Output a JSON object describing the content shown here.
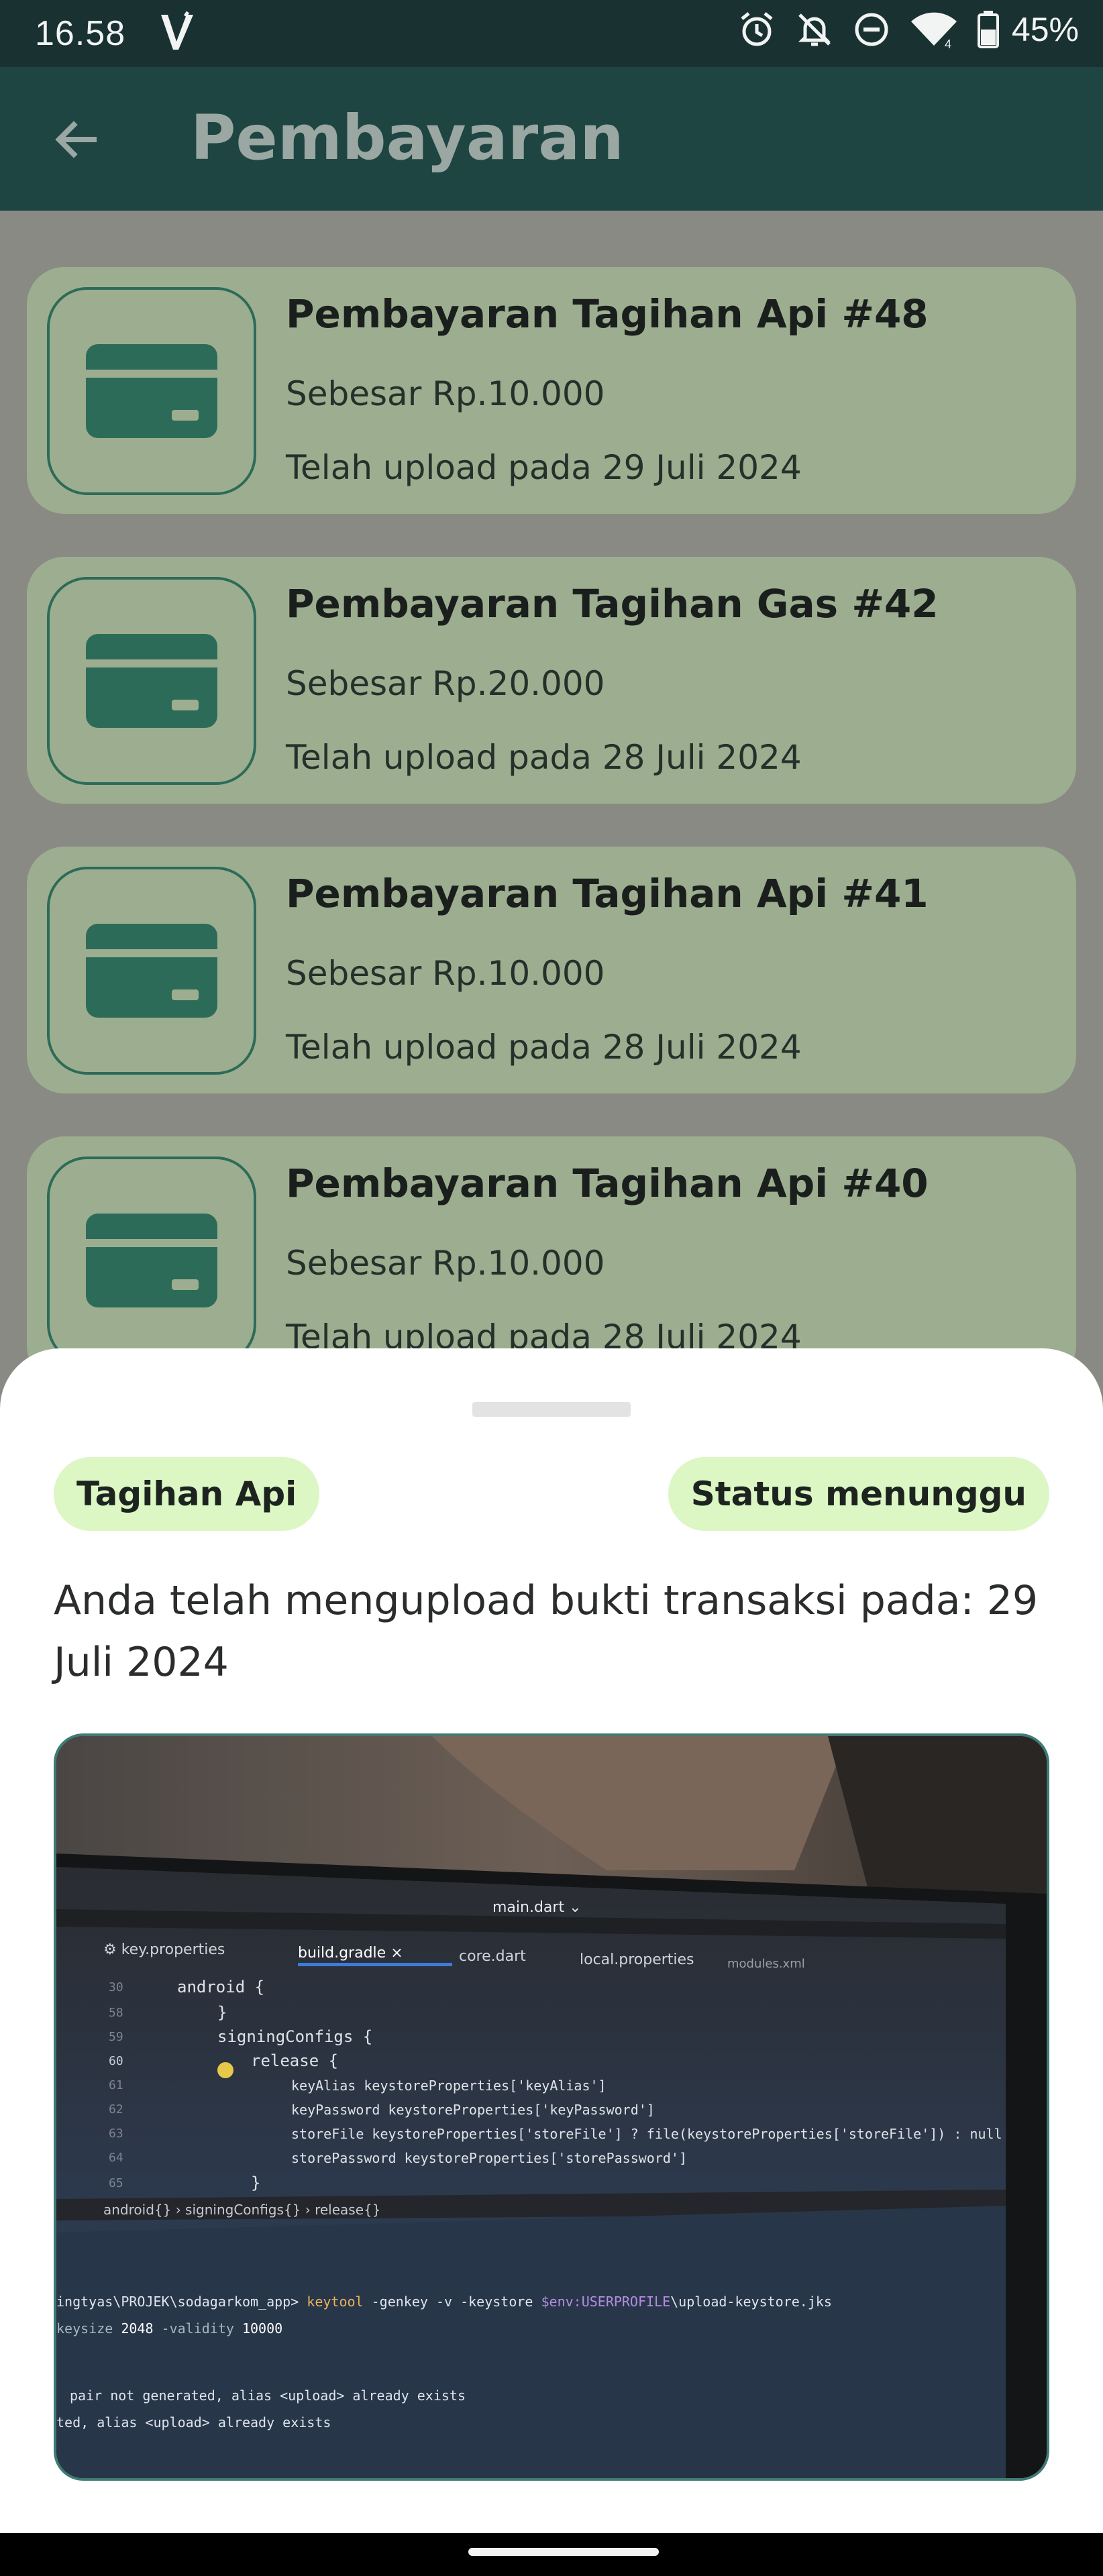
{
  "status_bar": {
    "time": "16.58",
    "carrier_icon": "v-logo-icon",
    "icons": [
      "alarm-icon",
      "bell-off-icon",
      "do-not-disturb-icon",
      "wifi-icon",
      "battery-icon"
    ],
    "battery": "45%"
  },
  "app_bar": {
    "back_icon": "arrow-left-icon",
    "title": "Pembayaran"
  },
  "payments": [
    {
      "title": "Pembayaran Tagihan Api #48",
      "amount": "Sebesar Rp.10.000",
      "date": "Telah upload pada 29 Juli 2024",
      "icon": "credit-card-icon"
    },
    {
      "title": "Pembayaran Tagihan Gas #42",
      "amount": "Sebesar Rp.20.000",
      "date": "Telah upload pada 28 Juli 2024",
      "icon": "credit-card-icon"
    },
    {
      "title": "Pembayaran Tagihan Api #41",
      "amount": "Sebesar Rp.10.000",
      "date": "Telah upload pada 28 Juli 2024",
      "icon": "credit-card-icon"
    },
    {
      "title": "Pembayaran Tagihan Api #40",
      "amount": "Sebesar Rp.10.000",
      "date": "Telah upload pada 28 Juli 2024",
      "icon": "credit-card-icon"
    }
  ],
  "sheet": {
    "bill_chip": "Tagihan Api",
    "status_chip": "Status menunggu",
    "message": "Anda telah mengupload bukti transaksi pada: 29 Juli 2024",
    "proof_photo": {
      "description_tabs": [
        "key.properties",
        "build.gradle",
        "core.dart",
        "local.properties",
        "modules.xml",
        "main.dart"
      ],
      "code_lines": [
        {
          "num": "30",
          "text": "android {"
        },
        {
          "num": "58",
          "text": "}"
        },
        {
          "num": "59",
          "text": "signingConfigs {"
        },
        {
          "num": "60",
          "text": "release {"
        },
        {
          "num": "61",
          "text": "keyAlias keystoreProperties['keyAlias']"
        },
        {
          "num": "62",
          "text": "keyPassword keystoreProperties['keyPassword']"
        },
        {
          "num": "63",
          "text": "storeFile keystoreProperties['storeFile'] ? file(keystoreProperties['storeFile']) : null"
        },
        {
          "num": "64",
          "text": "storePassword keystoreProperties['storePassword']"
        },
        {
          "num": "65",
          "text": "}"
        }
      ],
      "breadcrumb": "android{}  >  signingConfigs{}  >  release{}",
      "terminal_lines": [
        "ingtyas\\PROJEK\\sodagarkom_app> keytool -genkey -v -keystore $env:USERPROFILE\\upload-keystore.jks",
        "keysize 2048 -validity 10000",
        "pair not generated, alias <upload> already exists",
        "ted, alias <upload> already exists"
      ]
    }
  },
  "colors": {
    "status_bar": "#193231",
    "app_bar": "#1e4541",
    "card_bg": "#9cae8f",
    "card_icon": "#2d6b59",
    "chip_bg": "#dcf6c4"
  }
}
